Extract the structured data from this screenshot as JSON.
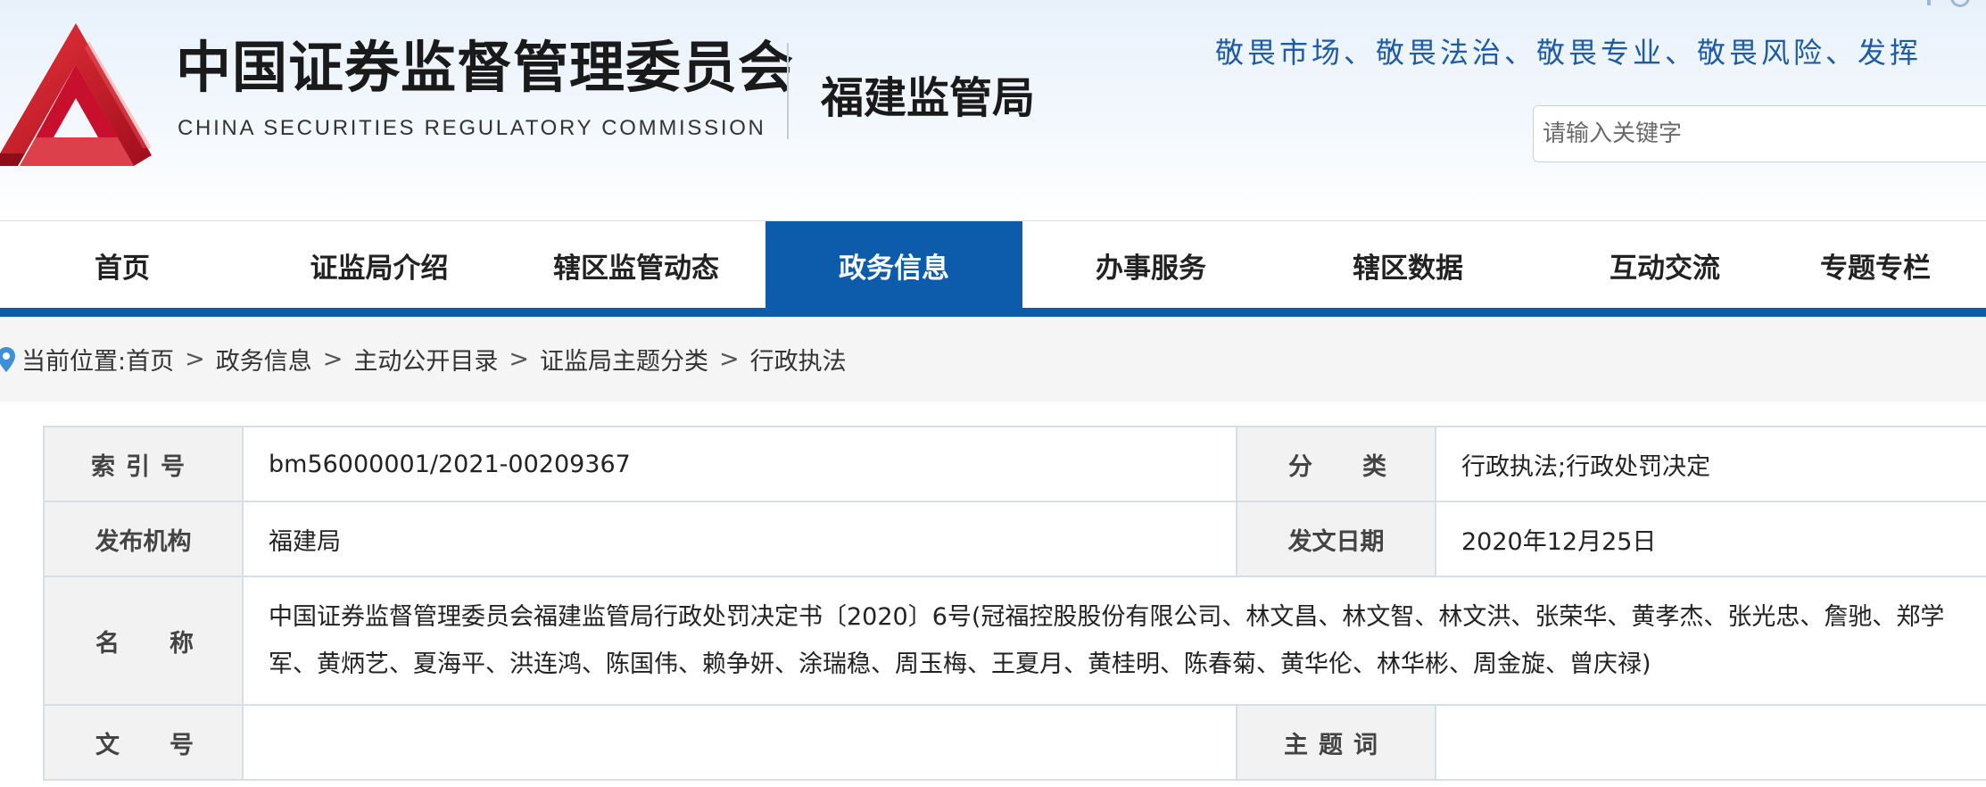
{
  "header": {
    "title_cn": "中国证券监督管理委员会",
    "title_en": "CHINA SECURITIES REGULATORY COMMISSION",
    "bureau": "福建监管局",
    "slogan": "敬畏市场、敬畏法治、敬畏专业、敬畏风险、发挥",
    "search_placeholder": "请输入关键字",
    "logo_color": "#c8102e"
  },
  "nav": {
    "items": [
      "首页",
      "证监局介绍",
      "辖区监管动态",
      "政务信息",
      "办事服务",
      "辖区数据",
      "互动交流",
      "专题专栏"
    ],
    "active_index": 3,
    "accent_color": "#0d5cab"
  },
  "breadcrumb": {
    "prefix": "当前位置:",
    "items": [
      "首页",
      "政务信息",
      "主动公开目录",
      "证监局主题分类",
      "行政执法"
    ],
    "separator": ">"
  },
  "info": {
    "index_label": "索引号",
    "index_value": "bm56000001/2021-00209367",
    "category_label": "分类",
    "category_value": "行政执法;行政处罚决定",
    "publisher_label": "发布机构",
    "publisher_value": "福建局",
    "date_label": "发文日期",
    "date_value": "2020年12月25日",
    "name_label": "名称",
    "name_value": "中国证券监督管理委员会福建监管局行政处罚决定书〔2020〕6号(冠福控股股份有限公司、林文昌、林文智、林文洪、张荣华、黄孝杰、张光忠、詹驰、郑学军、黄炳艺、夏海平、洪连鸿、陈国伟、赖争妍、涂瑞稳、周玉梅、王夏月、黄桂明、陈春菊、黄华伦、林华彬、周金旋、曾庆禄)",
    "docno_label": "文号",
    "docno_value": "",
    "keyword_label": "主题词",
    "keyword_value": ""
  }
}
